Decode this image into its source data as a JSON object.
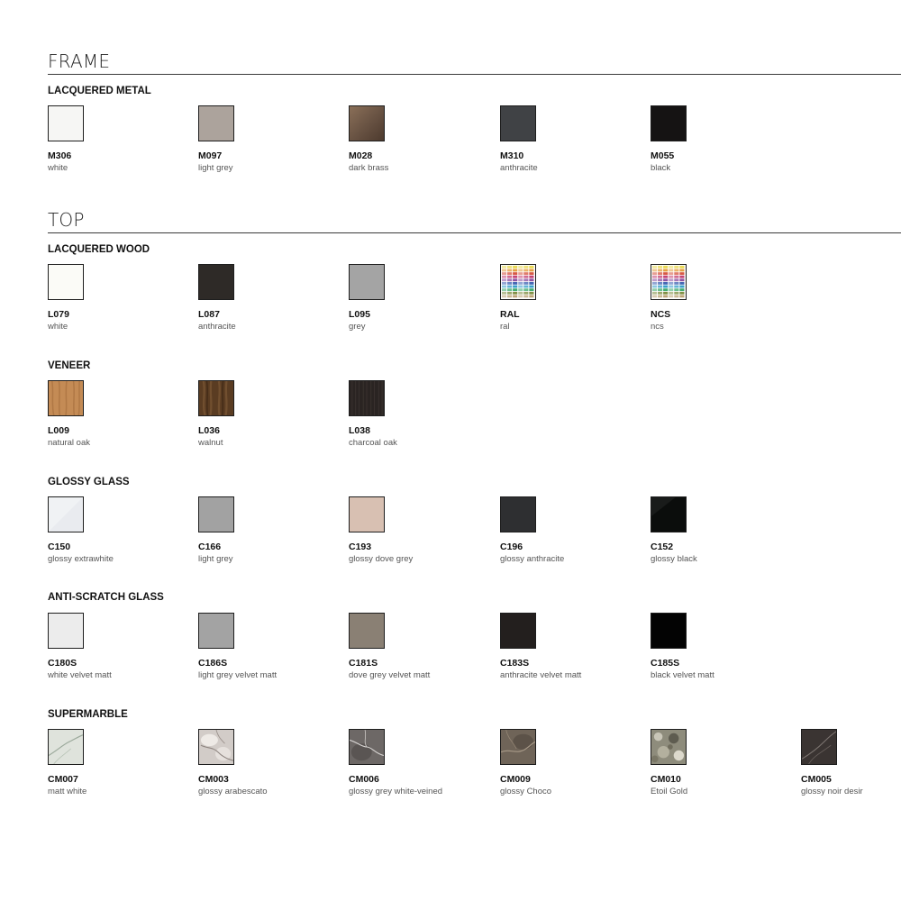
{
  "sections": [
    {
      "title": "FRAME",
      "groups": [
        {
          "title": "LACQUERED METAL",
          "items": [
            {
              "code": "M306",
              "name": "white",
              "color": "#f6f6f4"
            },
            {
              "code": "M097",
              "name": "light grey",
              "color": "#aca39c"
            },
            {
              "code": "M028",
              "name": "dark brass",
              "color": "#6a5444"
            },
            {
              "code": "M310",
              "name": "anthracite",
              "color": "#404245"
            },
            {
              "code": "M055",
              "name": "black",
              "color": "#151313"
            }
          ]
        }
      ]
    },
    {
      "title": "TOP",
      "groups": [
        {
          "title": "LACQUERED WOOD",
          "items": [
            {
              "code": "L079",
              "name": "white",
              "color": "#fbfbf7"
            },
            {
              "code": "L087",
              "name": "anthracite",
              "color": "#2e2a27"
            },
            {
              "code": "L095",
              "name": "grey",
              "color": "#a4a4a4"
            },
            {
              "code": "RAL",
              "name": "ral",
              "color": "multicolor",
              "icon": "color-chart-icon"
            },
            {
              "code": "NCS",
              "name": "ncs",
              "color": "multicolor",
              "icon": "color-chart-icon"
            }
          ]
        },
        {
          "title": "VENEER",
          "items": [
            {
              "code": "L009",
              "name": "natural oak",
              "color": "#c48b55",
              "icon": "wood-grain-icon"
            },
            {
              "code": "L036",
              "name": "walnut",
              "color": "#5a3c22",
              "icon": "wood-grain-icon"
            },
            {
              "code": "L038",
              "name": "charcoal oak",
              "color": "#2a2422",
              "icon": "wood-grain-icon"
            }
          ]
        },
        {
          "title": "GLOSSY GLASS",
          "items": [
            {
              "code": "C150",
              "name": "glossy extrawhite",
              "color": "#e9ebef"
            },
            {
              "code": "C166",
              "name": "light grey",
              "color": "#a2a2a2"
            },
            {
              "code": "C193",
              "name": "glossy dove grey",
              "color": "#d8c0b2"
            },
            {
              "code": "C196",
              "name": "glossy anthracite",
              "color": "#2e2f31"
            },
            {
              "code": "C152",
              "name": "glossy black",
              "color": "#0b0d0c"
            }
          ]
        },
        {
          "title": "ANTI-SCRATCH GLASS",
          "items": [
            {
              "code": "C180S",
              "name": "white velvet matt",
              "color": "#ececec"
            },
            {
              "code": "C186S",
              "name": "light grey velvet matt",
              "color": "#a3a3a3"
            },
            {
              "code": "C181S",
              "name": "dove grey velvet matt",
              "color": "#8a8074"
            },
            {
              "code": "C183S",
              "name": "anthracite velvet matt",
              "color": "#231f1e"
            },
            {
              "code": "C185S",
              "name": "black velvet matt",
              "color": "#030303"
            }
          ]
        },
        {
          "title": "SUPERMARBLE",
          "items": [
            {
              "code": "CM007",
              "name": "matt white",
              "color": "#dfe3dc",
              "icon": "marble-icon"
            },
            {
              "code": "CM003",
              "name": "glossy arabescato",
              "color": "#d2ccc8",
              "icon": "marble-icon"
            },
            {
              "code": "CM006",
              "name": "glossy grey white-veined",
              "color": "#6d6866",
              "icon": "marble-icon"
            },
            {
              "code": "CM009",
              "name": "glossy Choco",
              "color": "#6f6458",
              "icon": "marble-icon"
            },
            {
              "code": "CM010",
              "name": "Etoil Gold",
              "color": "#8e8c7c",
              "icon": "marble-icon"
            },
            {
              "code": "CM005",
              "name": "glossy noir desir",
              "color": "#3a3432",
              "icon": "marble-icon"
            }
          ]
        }
      ]
    }
  ]
}
